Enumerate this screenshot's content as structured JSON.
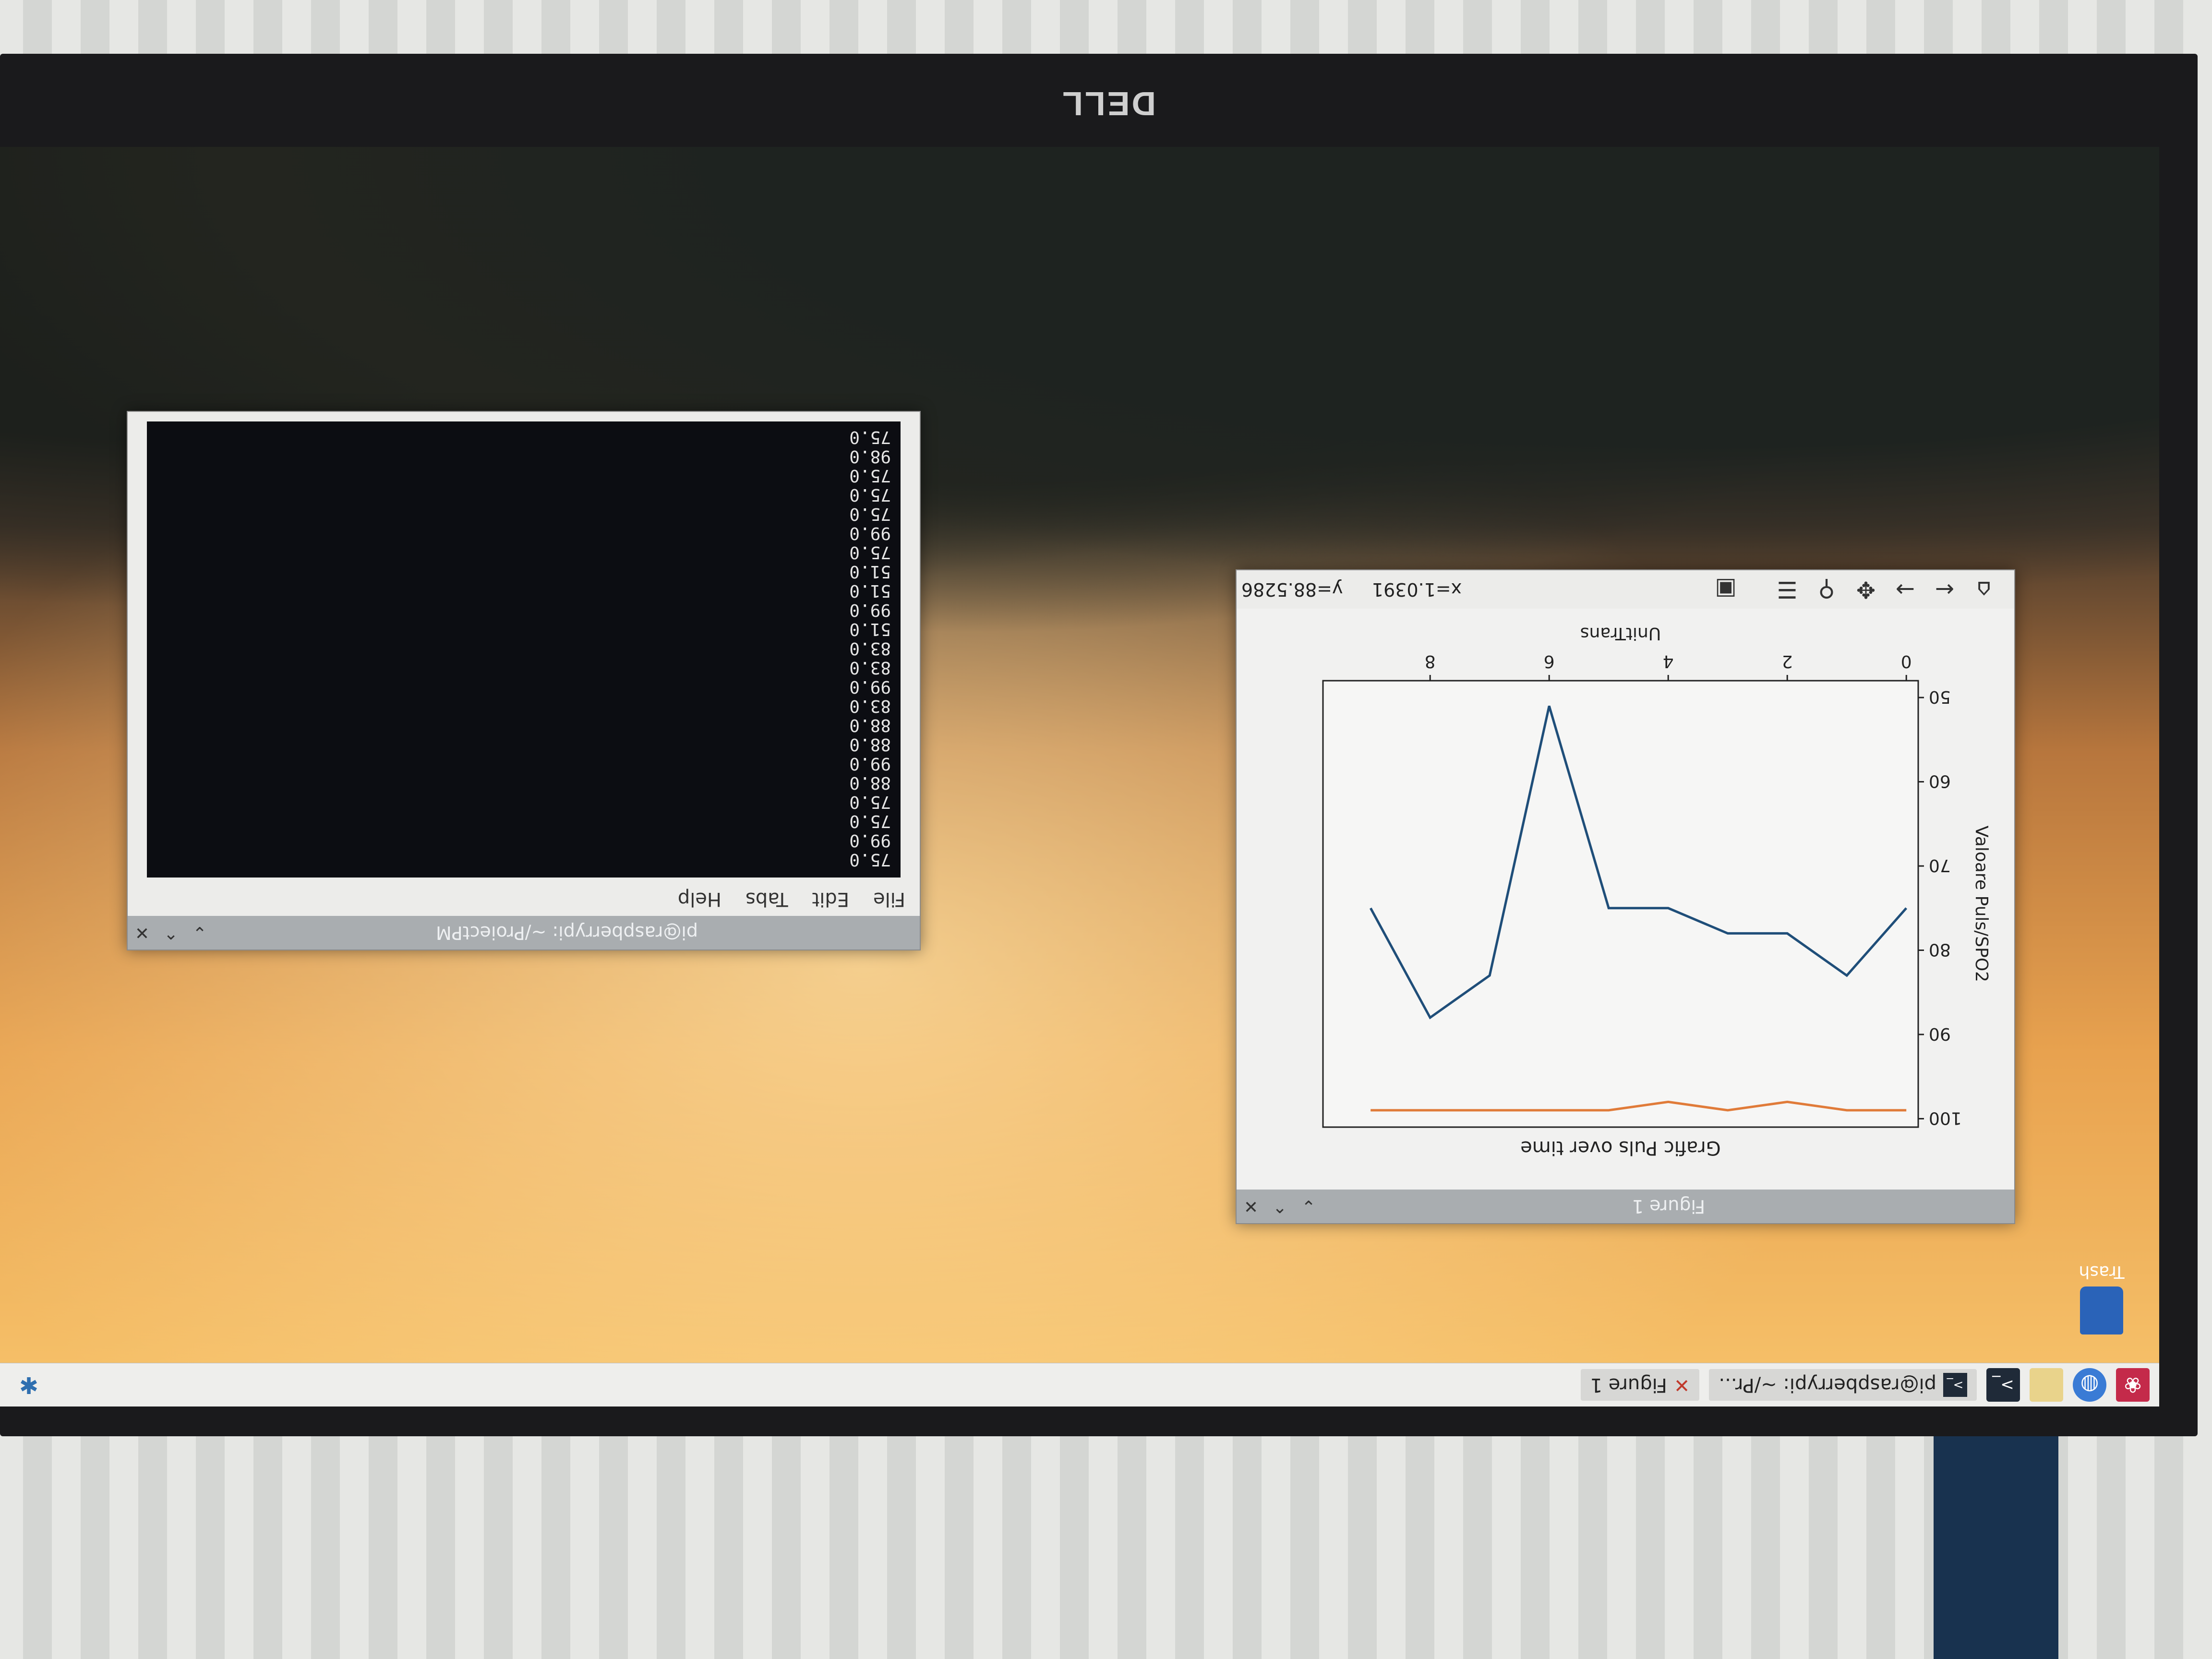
{
  "monitor": {
    "brand": "DELL"
  },
  "taskbar": {
    "tasks": [
      {
        "label": "pi@raspberrypi: ~/Pr..."
      },
      {
        "label": "Figure 1"
      }
    ]
  },
  "desktop": {
    "trash_label": "Trash"
  },
  "terminal": {
    "title": "pi@raspberrypi: ~/ProiectPM",
    "menu": [
      "File",
      "Edit",
      "Tabs",
      "Help"
    ],
    "lines": [
      "75.0",
      "99.0",
      "75.0",
      "75.0",
      "88.0",
      "99.0",
      "88.0",
      "88.0",
      "83.0",
      "99.0",
      "83.0",
      "83.0",
      "51.0",
      "99.0",
      "51.0",
      "51.0",
      "75.0",
      "99.0",
      "75.0",
      "75.0",
      "75.0",
      "98.0",
      "75.0"
    ]
  },
  "figure": {
    "title": "Figure 1",
    "coord_x": "x=1.0391",
    "coord_y": "y=88.5286",
    "icons": [
      "home-icon",
      "back-icon",
      "forward-icon",
      "pan-icon",
      "zoom-icon",
      "configure-icon",
      "save-icon"
    ]
  },
  "chart_data": {
    "type": "line",
    "title": "Grafic Puls over time",
    "xlabel": "UnitTrans",
    "ylabel": "Valoare Puls/SPO2",
    "xlim": [
      -0.2,
      9.8
    ],
    "ylim": [
      101,
      48
    ],
    "xticks": [
      "0",
      "2",
      "4",
      "6",
      "8"
    ],
    "yticks": [
      "50",
      "60",
      "70",
      "80",
      "90",
      "100"
    ],
    "series": [
      {
        "color": "#1f4e79",
        "x": [
          0,
          1,
          2,
          3,
          4,
          5,
          6,
          7,
          8,
          9
        ],
        "y": [
          75,
          83,
          78,
          78,
          75,
          75,
          51,
          83,
          88,
          75
        ]
      },
      {
        "color": "#e07b39",
        "x": [
          0,
          1,
          2,
          3,
          4,
          5,
          6,
          7,
          8,
          9
        ],
        "y": [
          99,
          99,
          98,
          99,
          98,
          99,
          99,
          99,
          99,
          99
        ]
      }
    ]
  }
}
